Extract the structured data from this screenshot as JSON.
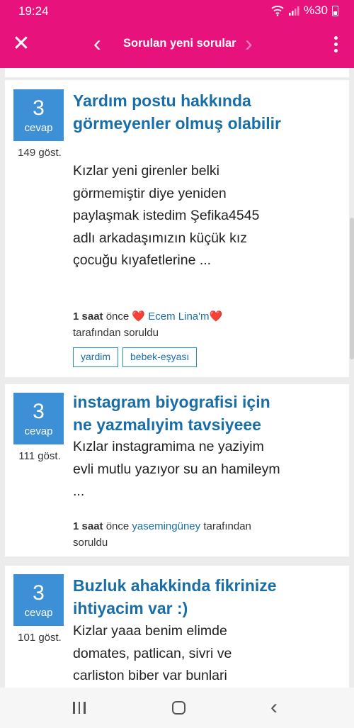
{
  "status_bar": {
    "time": "19:24",
    "wifi_icon": "wifi-icon",
    "signal_icon": "signal-icon",
    "battery": "%30"
  },
  "app_bar": {
    "title": "Sorulan yeni sorular",
    "close_icon": "close-icon",
    "prev_icon": "chevron-left-icon",
    "next_icon": "chevron-right-icon",
    "more_icon": "more-vertical-icon"
  },
  "questions": [
    {
      "answers": "3",
      "answers_label": "cevap",
      "views": "149 göst.",
      "title": "Yardım postu hakkında görmeyenler olmuş olabilir",
      "excerpt": "Kızlar yeni girenler belki görmemiştir diye yeniden paylaşmak istedim Şefika4545 adlı arkadaşımızın küçük kız çocuğu kıyafetlerine ...",
      "time_bold": "1 saat",
      "time_suffix": "önce",
      "author": "❤️ Ecem Lina'm❤️",
      "by_label": "tarafından soruldu",
      "tags": [
        "yardim",
        "bebek-eşyası"
      ]
    },
    {
      "answers": "3",
      "answers_label": "cevap",
      "views": "111 göst.",
      "title": "instagram biyografisi için ne yazmalıyim tavsiyeee",
      "excerpt": "Kızlar instagramima ne yaziyim evli mutlu yazıyor su an hamileym ...",
      "time_bold": "1 saat",
      "time_suffix": "önce",
      "author": "yasemingüney",
      "by_label": "tarafından soruldu"
    },
    {
      "answers": "3",
      "answers_label": "cevap",
      "views": "101 göst.",
      "title": "Buzluk ahakkinda fikrinize ihtiyacim var :)",
      "excerpt": "Kizlar yaaa benim elimde domates, patlican, sivri ve carliston biber var bunlari"
    }
  ],
  "nav_bar": {
    "recents_icon": "recent-apps-icon",
    "home_icon": "home-icon",
    "back_icon": "back-icon"
  },
  "colors": {
    "brand": "#e8127c",
    "badge": "#3d8fd6",
    "link": "#1a6ea8"
  }
}
